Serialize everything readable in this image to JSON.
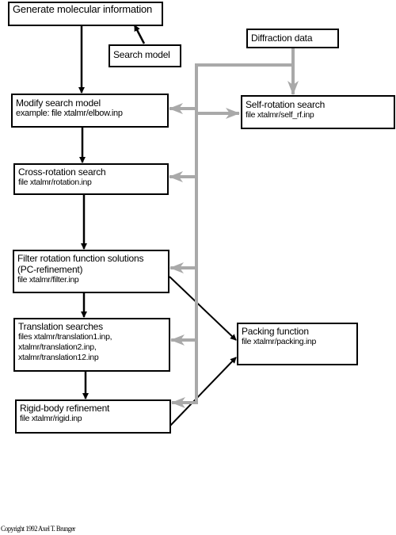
{
  "diagram": {
    "nodes": {
      "generate": {
        "title": "Generate molecular information",
        "lines": []
      },
      "search_model": {
        "title": "Search model",
        "lines": []
      },
      "diffraction": {
        "title": "Diffraction data",
        "lines": []
      },
      "modify": {
        "title": "Modify search model",
        "lines": [
          "example: file xtalmr/elbow.inp"
        ]
      },
      "self_rotation": {
        "title": "Self-rotation search",
        "lines": [
          "file xtalmr/self_rf.inp"
        ]
      },
      "cross_rotation": {
        "title": "Cross-rotation search",
        "lines": [
          "file xtalmr/rotation.inp"
        ]
      },
      "filter": {
        "title": "Filter rotation function solutions",
        "lines": [
          "(PC-refinement)",
          "file xtalmr/filter.inp"
        ]
      },
      "translation": {
        "title": "Translation searches",
        "lines": [
          "files xtalmr/translation1.inp,",
          "xtalmr/translation2.inp,",
          "xtalmr/translation12.inp"
        ]
      },
      "packing": {
        "title": "Packing function",
        "lines": [
          "file xtalmr/packing.inp"
        ]
      },
      "rigid": {
        "title": "Rigid-body refinement",
        "lines": [
          "file xtalmr/rigid.inp"
        ]
      }
    },
    "edges": {
      "black": [
        {
          "from": "search_model",
          "to": "generate"
        },
        {
          "from": "generate",
          "to": "modify"
        },
        {
          "from": "modify",
          "to": "cross_rotation"
        },
        {
          "from": "cross_rotation",
          "to": "filter"
        },
        {
          "from": "filter",
          "to": "translation"
        },
        {
          "from": "translation",
          "to": "rigid"
        },
        {
          "from": "filter",
          "to": "packing"
        },
        {
          "from": "rigid",
          "to": "packing"
        }
      ],
      "gray": [
        {
          "from": "diffraction",
          "to": "self_rotation"
        },
        {
          "from": "diffraction",
          "to": "modify"
        },
        {
          "from": "diffraction",
          "to": "self_rotation",
          "via": "bus"
        },
        {
          "from": "diffraction",
          "to": "cross_rotation"
        },
        {
          "from": "diffraction",
          "to": "filter"
        },
        {
          "from": "diffraction",
          "to": "translation"
        },
        {
          "from": "diffraction",
          "to": "rigid"
        }
      ]
    },
    "colors": {
      "primary_flow": "#000000",
      "data_flow": "#a9a9a9"
    }
  },
  "footer": {
    "copyright": "Copyright 1992 Axel T. Brunger"
  }
}
